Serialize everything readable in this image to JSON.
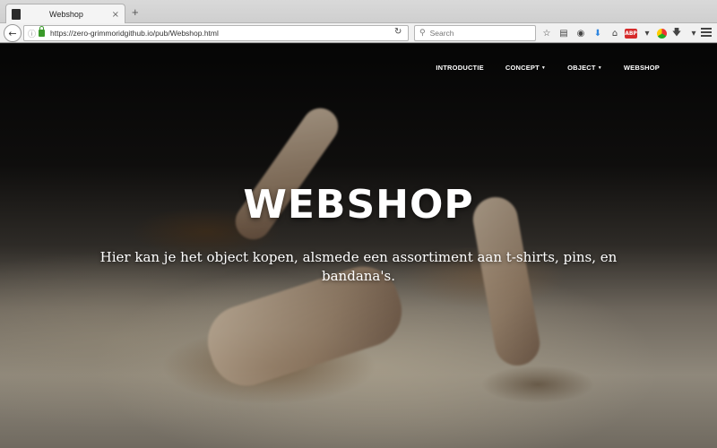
{
  "browser": {
    "tab_title": "Webshop",
    "tab_close": "×",
    "new_tab": "+",
    "url": "https://zero-grimmoridgithub.io/pub/Webshop.html",
    "search_placeholder": "Search"
  },
  "site_nav": {
    "items": [
      {
        "label": "INTRODUCTIE",
        "dropdown": false
      },
      {
        "label": "CONCEPT",
        "dropdown": true
      },
      {
        "label": "OBJECT",
        "dropdown": true
      },
      {
        "label": "WEBSHOP",
        "dropdown": false
      }
    ]
  },
  "hero": {
    "title": "WEBSHOP",
    "subtitle": "Hier kan je het object kopen, alsmede een assortiment aan t-shirts, pins, en bandana's."
  },
  "colors": {
    "text": "#ffffff",
    "lock": "#3a9a2a",
    "download_icon": "#2f86e0"
  }
}
